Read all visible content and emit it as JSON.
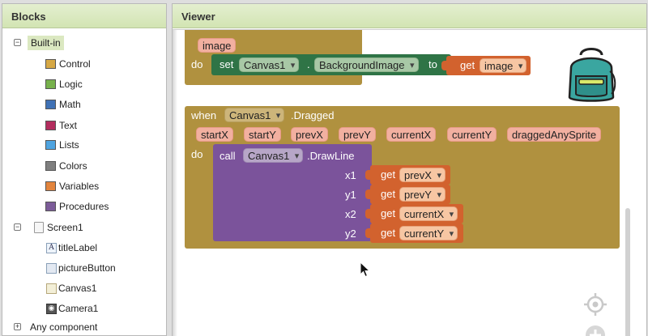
{
  "blocks_panel": {
    "title": "Blocks",
    "builtin": {
      "label": "Built-in",
      "toggle": "−",
      "items": [
        {
          "label": "Control",
          "color": "#d6a845"
        },
        {
          "label": "Logic",
          "color": "#77b14c"
        },
        {
          "label": "Math",
          "color": "#3f71b5"
        },
        {
          "label": "Text",
          "color": "#b32d5e"
        },
        {
          "label": "Lists",
          "color": "#4fa4e0"
        },
        {
          "label": "Colors",
          "color": "#7f7f7f"
        },
        {
          "label": "Variables",
          "color": "#e2843d"
        },
        {
          "label": "Procedures",
          "color": "#7c5c99"
        }
      ]
    },
    "screen": {
      "label": "Screen1",
      "toggle": "−",
      "components": [
        {
          "label": "titleLabel",
          "icon": "label-icon"
        },
        {
          "label": "pictureButton",
          "icon": "button-icon"
        },
        {
          "label": "Canvas1",
          "icon": "canvas-icon"
        },
        {
          "label": "Camera1",
          "icon": "camera-icon"
        }
      ]
    },
    "any_component": {
      "label": "Any component",
      "toggle": "+"
    }
  },
  "viewer": {
    "title": "Viewer",
    "block1": {
      "param": "image",
      "do_label": "do",
      "set_label": "set",
      "component": "Canvas1",
      "dot": ".",
      "property": "BackgroundImage",
      "to_label": "to",
      "get_label": "get",
      "get_value": "image"
    },
    "block2": {
      "when_label": "when",
      "component": "Canvas1",
      "event": ".Dragged",
      "params": [
        "startX",
        "startY",
        "prevX",
        "prevY",
        "currentX",
        "currentY",
        "draggedAnySprite"
      ],
      "do_label": "do",
      "call_label": "call",
      "call_component": "Canvas1",
      "method": ".DrawLine",
      "args": [
        {
          "name": "x1",
          "get": "get",
          "value": "prevX"
        },
        {
          "name": "y1",
          "get": "get",
          "value": "prevY"
        },
        {
          "name": "x2",
          "get": "get",
          "value": "currentX"
        },
        {
          "name": "y2",
          "get": "get",
          "value": "currentY"
        }
      ]
    },
    "colors": {
      "event_block": "#b0913f",
      "set_block": "#2f7446",
      "call_block": "#7b539b",
      "get_block": "#d2622e",
      "header_bg": "#d8e7bd"
    }
  }
}
